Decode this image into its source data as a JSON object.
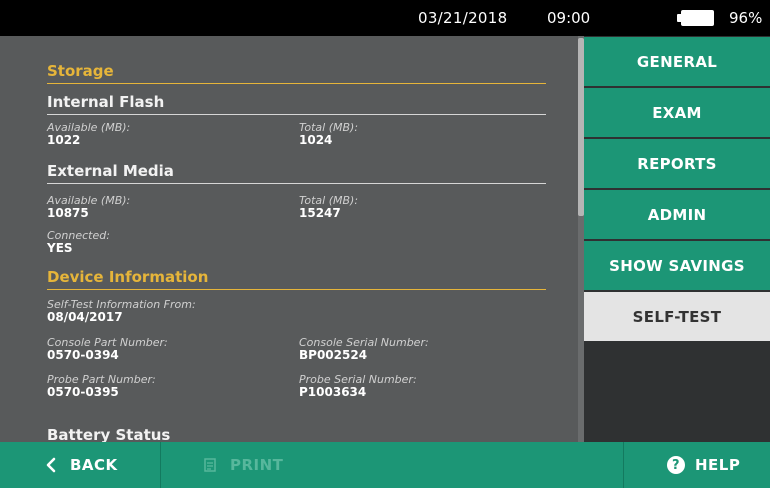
{
  "status": {
    "date": "03/21/2018",
    "time": "09:00",
    "battery_pct": "96%"
  },
  "content": {
    "storage_title": "Storage",
    "internal_title": "Internal Flash",
    "internal": {
      "avail_label": "Available (MB):",
      "avail_value": "1022",
      "total_label": "Total (MB):",
      "total_value": "1024"
    },
    "external_title": "External Media",
    "external": {
      "avail_label": "Available (MB):",
      "avail_value": "10875",
      "total_label": "Total (MB):",
      "total_value": "15247",
      "connected_label": "Connected:",
      "connected_value": "YES"
    },
    "device_title": "Device Information",
    "device": {
      "selftest_label": "Self-Test Information From:",
      "selftest_value": "08/04/2017",
      "console_part_label": "Console Part Number:",
      "console_part_value": "0570-0394",
      "console_serial_label": "Console Serial Number:",
      "console_serial_value": "BP002524",
      "probe_part_label": "Probe Part Number:",
      "probe_part_value": "0570-0395",
      "probe_serial_label": "Probe Serial Number:",
      "probe_serial_value": "P1003634"
    },
    "battery_title": "Battery Status"
  },
  "nav": {
    "items": [
      "GENERAL",
      "EXAM",
      "REPORTS",
      "ADMIN",
      "SHOW SAVINGS",
      "SELF-TEST"
    ],
    "active": "SELF-TEST"
  },
  "bottom": {
    "back": "BACK",
    "print": "PRINT",
    "help": "HELP"
  },
  "colors": {
    "accent": "#1c9676",
    "section_gold": "#e6b53a",
    "panel": "#585a5b"
  }
}
